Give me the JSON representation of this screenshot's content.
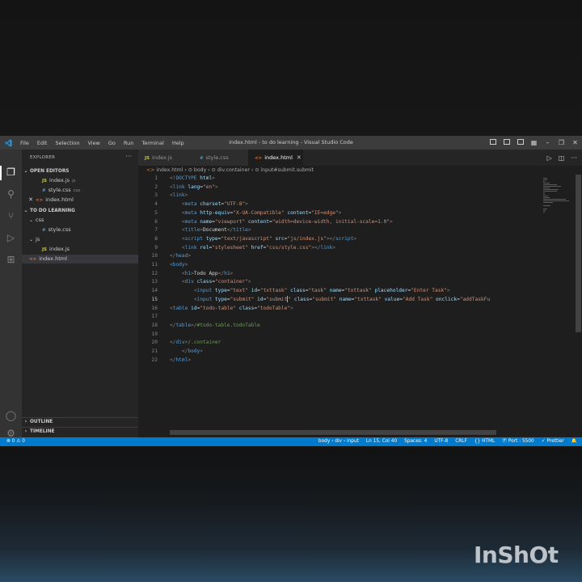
{
  "window": {
    "title": "index.html - to do learning - Visual Studio Code",
    "menu": [
      "File",
      "Edit",
      "Selection",
      "View",
      "Go",
      "Run",
      "Terminal",
      "Help"
    ]
  },
  "sidebar": {
    "title": "EXPLORER",
    "open_editors": {
      "label": "OPEN EDITORS",
      "items": [
        {
          "icon": "JS",
          "name": "index.js",
          "path": "js"
        },
        {
          "icon": "#",
          "name": "style.css",
          "path": "css"
        },
        {
          "icon": "<>",
          "name": "index.html",
          "path": ""
        }
      ]
    },
    "workspace": {
      "label": "TO DO LEARNING",
      "folder_css": "css",
      "file_style": "style.css",
      "folder_js": "js",
      "file_index_js": "index.js",
      "file_index_html": "index.html"
    },
    "outline_label": "OUTLINE",
    "timeline_label": "TIMELINE"
  },
  "tabs": [
    {
      "icon": "JS",
      "label": "index.js"
    },
    {
      "icon": "#",
      "label": "style.css"
    },
    {
      "icon": "<>",
      "label": "index.html"
    }
  ],
  "breadcrumb": [
    "index.html",
    "body",
    "div.container",
    "input#submit.submit"
  ],
  "code_lines": [
    [
      [
        "br",
        "<!"
      ],
      [
        "tag",
        "DOCTYPE"
      ],
      [
        "txt",
        " "
      ],
      [
        "attr",
        "html"
      ],
      [
        "br",
        ">"
      ]
    ],
    [
      [
        "br",
        "<"
      ],
      [
        "tag",
        "link"
      ],
      [
        "txt",
        " "
      ],
      [
        "attr",
        "lang"
      ],
      [
        "txt",
        "="
      ],
      [
        "str",
        "\"en\""
      ],
      [
        "br",
        ">"
      ]
    ],
    [
      [
        "br",
        "<"
      ],
      [
        "tag",
        "link"
      ],
      [
        "br",
        ">"
      ]
    ],
    [
      [
        "txt",
        "    "
      ],
      [
        "br",
        "<"
      ],
      [
        "tag",
        "meta"
      ],
      [
        "txt",
        " "
      ],
      [
        "attr",
        "charset"
      ],
      [
        "txt",
        "="
      ],
      [
        "str",
        "\"UTF-8\""
      ],
      [
        "br",
        ">"
      ]
    ],
    [
      [
        "txt",
        "    "
      ],
      [
        "br",
        "<"
      ],
      [
        "tag",
        "meta"
      ],
      [
        "txt",
        " "
      ],
      [
        "attr",
        "http-equiv"
      ],
      [
        "txt",
        "="
      ],
      [
        "str",
        "\"X-UA-Compatible\""
      ],
      [
        "txt",
        " "
      ],
      [
        "attr",
        "content"
      ],
      [
        "txt",
        "="
      ],
      [
        "str",
        "\"IE=edge\""
      ],
      [
        "br",
        ">"
      ]
    ],
    [
      [
        "txt",
        "    "
      ],
      [
        "br",
        "<"
      ],
      [
        "tag",
        "meta"
      ],
      [
        "txt",
        " "
      ],
      [
        "attr",
        "name"
      ],
      [
        "txt",
        "="
      ],
      [
        "str",
        "\"viewport\""
      ],
      [
        "txt",
        " "
      ],
      [
        "attr",
        "content"
      ],
      [
        "txt",
        "="
      ],
      [
        "str",
        "\"width=device-width, initial-scale=1.0\""
      ],
      [
        "br",
        ">"
      ]
    ],
    [
      [
        "txt",
        "    "
      ],
      [
        "br",
        "<"
      ],
      [
        "tag",
        "title"
      ],
      [
        "br",
        ">"
      ],
      [
        "txt",
        "Document"
      ],
      [
        "br",
        "</"
      ],
      [
        "tag",
        "title"
      ],
      [
        "br",
        ">"
      ]
    ],
    [
      [
        "txt",
        "    "
      ],
      [
        "br",
        "<"
      ],
      [
        "tag",
        "script"
      ],
      [
        "txt",
        " "
      ],
      [
        "attr",
        "type"
      ],
      [
        "txt",
        "="
      ],
      [
        "str",
        "\"text/javascript\""
      ],
      [
        "txt",
        " "
      ],
      [
        "attr",
        "src"
      ],
      [
        "txt",
        "="
      ],
      [
        "str",
        "\"js/index.js\""
      ],
      [
        "br",
        "></"
      ],
      [
        "tag",
        "script"
      ],
      [
        "br",
        ">"
      ]
    ],
    [
      [
        "txt",
        "    "
      ],
      [
        "br",
        "<"
      ],
      [
        "tag",
        "link"
      ],
      [
        "txt",
        " "
      ],
      [
        "attr",
        "rel"
      ],
      [
        "txt",
        "="
      ],
      [
        "str",
        "\"stylesheet\""
      ],
      [
        "txt",
        " "
      ],
      [
        "attr",
        "href"
      ],
      [
        "txt",
        "="
      ],
      [
        "str",
        "\"css/style.css\""
      ],
      [
        "br",
        "></"
      ],
      [
        "tag",
        "link"
      ],
      [
        "br",
        ">"
      ]
    ],
    [
      [
        "br",
        "</"
      ],
      [
        "tag",
        "head"
      ],
      [
        "br",
        ">"
      ]
    ],
    [
      [
        "br",
        "<"
      ],
      [
        "tag",
        "body"
      ],
      [
        "br",
        ">"
      ]
    ],
    [
      [
        "txt",
        "    "
      ],
      [
        "br",
        "<"
      ],
      [
        "tag",
        "h1"
      ],
      [
        "br",
        ">"
      ],
      [
        "txt",
        "Todo App"
      ],
      [
        "br",
        "</"
      ],
      [
        "tag",
        "h1"
      ],
      [
        "br",
        ">"
      ]
    ],
    [
      [
        "txt",
        "    "
      ],
      [
        "br",
        "<"
      ],
      [
        "tag",
        "div"
      ],
      [
        "txt",
        " "
      ],
      [
        "attr",
        "class"
      ],
      [
        "txt",
        "="
      ],
      [
        "str",
        "\"container\""
      ],
      [
        "br",
        ">"
      ]
    ],
    [
      [
        "txt",
        "        "
      ],
      [
        "br",
        "<"
      ],
      [
        "tag",
        "input"
      ],
      [
        "txt",
        " "
      ],
      [
        "attr",
        "type"
      ],
      [
        "txt",
        "="
      ],
      [
        "str",
        "\"text\""
      ],
      [
        "txt",
        " "
      ],
      [
        "attr",
        "id"
      ],
      [
        "txt",
        "="
      ],
      [
        "str",
        "\"txttask\""
      ],
      [
        "txt",
        " "
      ],
      [
        "attr",
        "class"
      ],
      [
        "txt",
        "="
      ],
      [
        "str",
        "\"task\""
      ],
      [
        "txt",
        " "
      ],
      [
        "attr",
        "name"
      ],
      [
        "txt",
        "="
      ],
      [
        "str",
        "\"txttask\""
      ],
      [
        "txt",
        " "
      ],
      [
        "attr",
        "placeholder"
      ],
      [
        "txt",
        "="
      ],
      [
        "str",
        "\"Enter Task\""
      ],
      [
        "br",
        ">"
      ]
    ],
    [
      [
        "txt",
        "        "
      ],
      [
        "br",
        "<"
      ],
      [
        "tag",
        "input"
      ],
      [
        "txt",
        " "
      ],
      [
        "attr",
        "type"
      ],
      [
        "txt",
        "="
      ],
      [
        "str",
        "\"submit\""
      ],
      [
        "txt",
        " "
      ],
      [
        "attr",
        "id"
      ],
      [
        "txt",
        "="
      ],
      [
        "str",
        "\"submit"
      ],
      [
        "cursor",
        ""
      ],
      [
        "str",
        "\""
      ],
      [
        "txt",
        " "
      ],
      [
        "attr",
        "class"
      ],
      [
        "txt",
        "="
      ],
      [
        "str",
        "\"submit\""
      ],
      [
        "txt",
        " "
      ],
      [
        "attr",
        "name"
      ],
      [
        "txt",
        "="
      ],
      [
        "str",
        "\"txttask\""
      ],
      [
        "txt",
        " "
      ],
      [
        "attr",
        "value"
      ],
      [
        "txt",
        "="
      ],
      [
        "str",
        "\"Add Task\""
      ],
      [
        "txt",
        " "
      ],
      [
        "attr",
        "onclick"
      ],
      [
        "txt",
        "="
      ],
      [
        "str",
        "\"addTaskFu"
      ]
    ],
    [
      [
        "br",
        "<"
      ],
      [
        "tag",
        "table"
      ],
      [
        "txt",
        " "
      ],
      [
        "attr",
        "id"
      ],
      [
        "txt",
        "="
      ],
      [
        "str",
        "\"todo-table\""
      ],
      [
        "txt",
        " "
      ],
      [
        "attr",
        "class"
      ],
      [
        "txt",
        "="
      ],
      [
        "str",
        "\"todoTable\""
      ],
      [
        "br",
        ">"
      ]
    ],
    [],
    [
      [
        "br",
        "</"
      ],
      [
        "tag",
        "table"
      ],
      [
        "br",
        ">"
      ],
      [
        "com",
        "/#todo-table.todoTable"
      ]
    ],
    [],
    [
      [
        "br",
        "</"
      ],
      [
        "tag",
        "div"
      ],
      [
        "br",
        ">"
      ],
      [
        "com",
        "/.container"
      ]
    ],
    [
      [
        "txt",
        "    "
      ],
      [
        "br",
        "</"
      ],
      [
        "tag",
        "body"
      ],
      [
        "br",
        ">"
      ]
    ],
    [
      [
        "br",
        "</"
      ],
      [
        "tag",
        "html"
      ],
      [
        "br",
        ">"
      ]
    ]
  ],
  "current_line": 15,
  "status": {
    "left": "⊗ 0 ⚠ 0",
    "items": [
      "body › div › input",
      "Ln 15, Col 40",
      "Spaces: 4",
      "UTF-8",
      "CRLF",
      "{} HTML",
      "Ⓟ Port : 5500",
      "✓ Prettier",
      "🔔"
    ]
  },
  "watermark": "InShOt"
}
